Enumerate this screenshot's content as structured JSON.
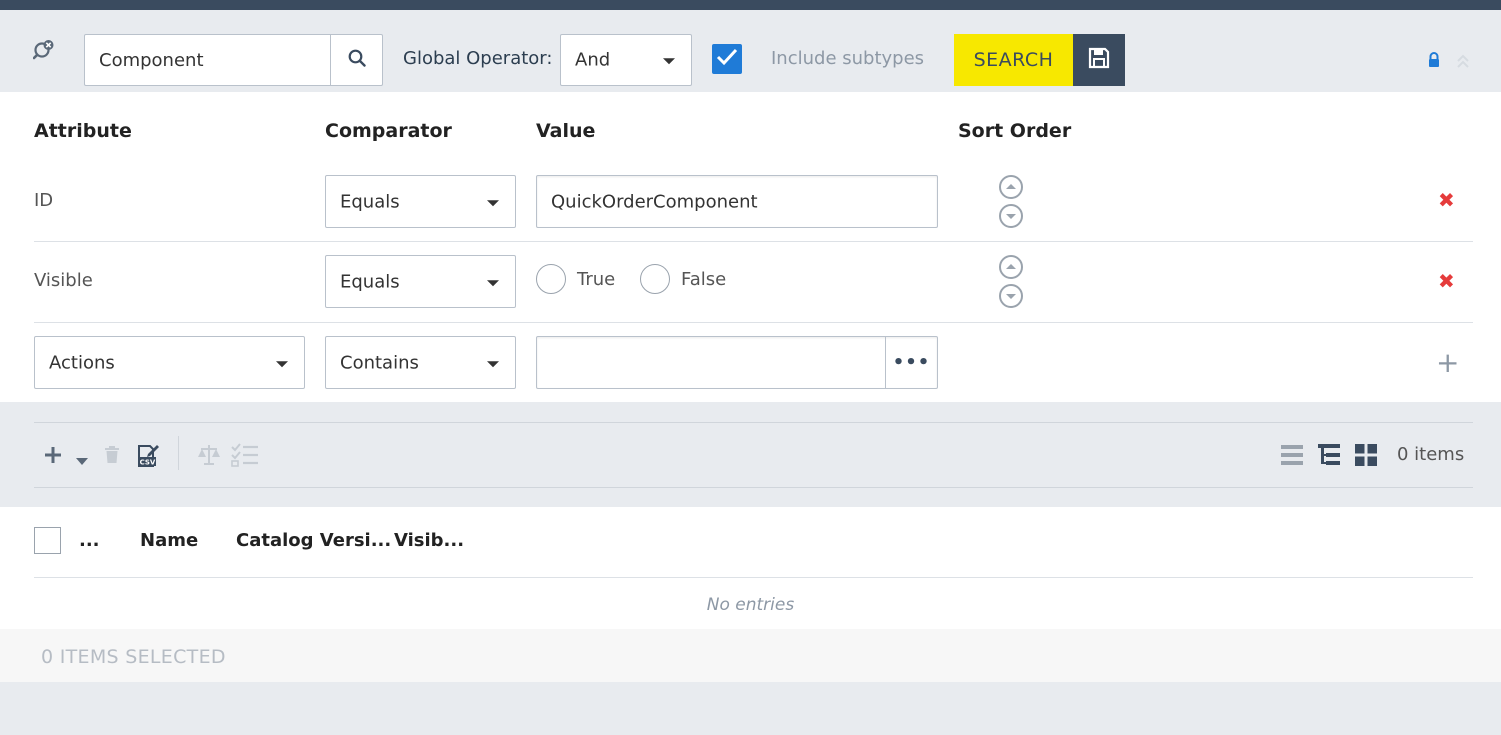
{
  "search": {
    "type_value": "Component",
    "global_operator_label": "Global Operator:",
    "global_operator_value": "And",
    "include_subtypes_label": "Include subtypes",
    "include_subtypes_checked": true,
    "search_button": "SEARCH"
  },
  "conditions": {
    "headers": {
      "attribute": "Attribute",
      "comparator": "Comparator",
      "value": "Value",
      "sort_order": "Sort Order"
    },
    "rows": [
      {
        "attribute": "ID",
        "comparator": "Equals",
        "value": "QuickOrderComponent"
      },
      {
        "attribute": "Visible",
        "comparator": "Equals",
        "true_label": "True",
        "false_label": "False"
      },
      {
        "attribute": "Actions",
        "comparator": "Contains",
        "value": ""
      }
    ],
    "ellipsis": "•••"
  },
  "toolbar": {
    "items_count": "0 items"
  },
  "list": {
    "columns": [
      "...",
      "Name",
      "Catalog Versi...",
      "Visib..."
    ],
    "empty_message": "No entries"
  },
  "footer": {
    "selected_count": "0 ITEMS SELECTED"
  },
  "colors": {
    "accent": "#1f7bd7",
    "search_button": "#f7e800",
    "dark": "#3a4b5f",
    "remove": "#e53b3b"
  }
}
